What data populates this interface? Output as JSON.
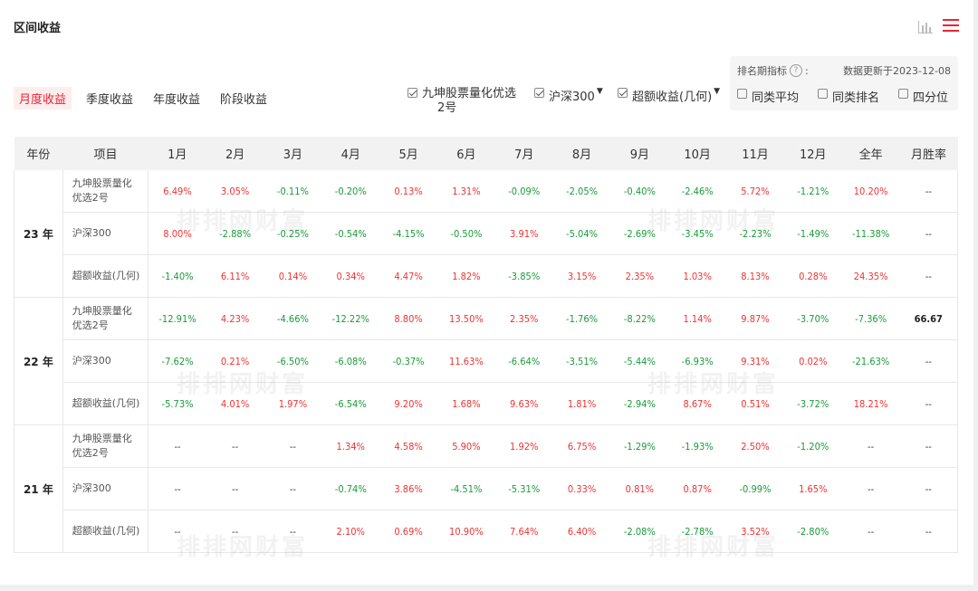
{
  "header": {
    "title": "区间收益",
    "chart_icon": "bar-chart-icon",
    "menu_icon": "hamburger-menu-icon"
  },
  "tabs": [
    "月度收益",
    "季度收益",
    "年度收益",
    "阶段收益"
  ],
  "legend": {
    "fund_line1": "九坤股票量化优选",
    "fund_line2": "2号",
    "benchmark": "沪深300",
    "excess": "超额收益(几何)"
  },
  "ranking": {
    "label": "排名期指标",
    "help": "?",
    "colon": ":",
    "updated": "数据更新于2023-12-08",
    "options": [
      "同类平均",
      "同类排名",
      "四分位"
    ]
  },
  "table": {
    "headers": [
      "年份",
      "项目",
      "1月",
      "2月",
      "3月",
      "4月",
      "5月",
      "6月",
      "7月",
      "8月",
      "9月",
      "10月",
      "11月",
      "12月",
      "全年",
      "月胜率"
    ],
    "groups": [
      {
        "year": "23 年",
        "rows": [
          {
            "item_line1": "九坤股票量化",
            "item_line2": "优选2号",
            "cells": [
              "6.49%",
              "3.05%",
              "-0.11%",
              "-0.20%",
              "0.13%",
              "1.31%",
              "-0.09%",
              "-2.05%",
              "-0.40%",
              "-2.46%",
              "5.72%",
              "-1.21%",
              "10.20%",
              "--"
            ]
          },
          {
            "item_line1": "沪深300",
            "item_line2": "",
            "cells": [
              "8.00%",
              "-2.88%",
              "-0.25%",
              "-0.54%",
              "-4.15%",
              "-0.50%",
              "3.91%",
              "-5.04%",
              "-2.69%",
              "-3.45%",
              "-2.23%",
              "-1.49%",
              "-11.38%",
              "--"
            ]
          },
          {
            "item_line1": "超额收益(几何)",
            "item_line2": "",
            "cells": [
              "-1.40%",
              "6.11%",
              "0.14%",
              "0.34%",
              "4.47%",
              "1.82%",
              "-3.85%",
              "3.15%",
              "2.35%",
              "1.03%",
              "8.13%",
              "0.28%",
              "24.35%",
              "--"
            ]
          }
        ]
      },
      {
        "year": "22 年",
        "rows": [
          {
            "item_line1": "九坤股票量化",
            "item_line2": "优选2号",
            "cells": [
              "-12.91%",
              "4.23%",
              "-4.66%",
              "-12.22%",
              "8.80%",
              "13.50%",
              "2.35%",
              "-1.76%",
              "-8.22%",
              "1.14%",
              "9.87%",
              "-3.70%",
              "-7.36%",
              "66.67"
            ]
          },
          {
            "item_line1": "沪深300",
            "item_line2": "",
            "cells": [
              "-7.62%",
              "0.21%",
              "-6.50%",
              "-6.08%",
              "-0.37%",
              "11.63%",
              "-6.64%",
              "-3.51%",
              "-5.44%",
              "-6.93%",
              "9.31%",
              "0.02%",
              "-21.63%",
              "--"
            ]
          },
          {
            "item_line1": "超额收益(几何)",
            "item_line2": "",
            "cells": [
              "-5.73%",
              "4.01%",
              "1.97%",
              "-6.54%",
              "9.20%",
              "1.68%",
              "9.63%",
              "1.81%",
              "-2.94%",
              "8.67%",
              "0.51%",
              "-3.72%",
              "18.21%",
              "--"
            ]
          }
        ]
      },
      {
        "year": "21 年",
        "rows": [
          {
            "item_line1": "九坤股票量化",
            "item_line2": "优选2号",
            "cells": [
              "--",
              "--",
              "--",
              "1.34%",
              "4.58%",
              "5.90%",
              "1.92%",
              "6.75%",
              "-1.29%",
              "-1.93%",
              "2.50%",
              "-1.20%",
              "--",
              "--"
            ]
          },
          {
            "item_line1": "沪深300",
            "item_line2": "",
            "cells": [
              "--",
              "--",
              "--",
              "-0.74%",
              "3.86%",
              "-4.51%",
              "-5.31%",
              "0.33%",
              "0.81%",
              "0.87%",
              "-0.99%",
              "1.65%",
              "--",
              "--"
            ]
          },
          {
            "item_line1": "超额收益(几何)",
            "item_line2": "",
            "cells": [
              "--",
              "--",
              "--",
              "2.10%",
              "0.69%",
              "10.90%",
              "7.64%",
              "6.40%",
              "-2.08%",
              "-2.78%",
              "3.52%",
              "-2.80%",
              "--",
              "--"
            ]
          }
        ]
      }
    ]
  },
  "watermark": "排排网财富",
  "colors": {
    "positive": "#e33333",
    "negative": "#1a9a3a",
    "accent": "#e23333"
  }
}
